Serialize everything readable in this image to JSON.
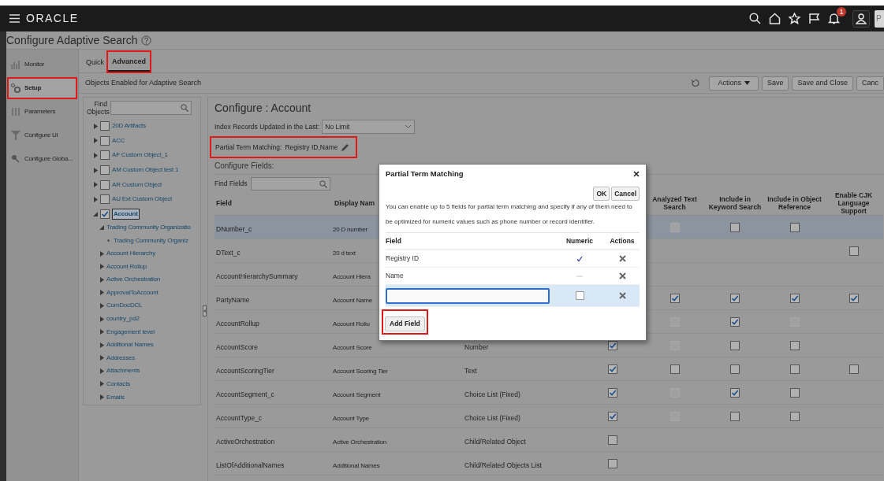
{
  "header": {
    "logo": "ORACLE",
    "notification_badge": "1",
    "avatar": "P"
  },
  "page_title": "Configure Adaptive Search",
  "nav": [
    {
      "label": "Monitor",
      "selected": false,
      "highlighted": false
    },
    {
      "label": "Setup",
      "selected": true,
      "highlighted": true
    },
    {
      "label": "Parameters",
      "selected": false,
      "highlighted": false
    },
    {
      "label": "Configure UI",
      "selected": false,
      "highlighted": false
    },
    {
      "label": "Configure Globa...",
      "selected": false,
      "highlighted": false
    }
  ],
  "tabs": [
    {
      "label": "Quick",
      "selected": false,
      "highlighted": false
    },
    {
      "label": "Advanced",
      "selected": true,
      "highlighted": true
    }
  ],
  "section_title": "Objects Enabled for Adaptive Search",
  "toolbar": [
    {
      "label": "Actions",
      "kind": "menu"
    },
    {
      "label": "Save",
      "kind": "button"
    },
    {
      "label": "Save and Close",
      "kind": "button"
    },
    {
      "label": "Canc",
      "kind": "button"
    }
  ],
  "object_search": {
    "label": "Find Objects"
  },
  "objects": [
    {
      "label": "20D Artifacts",
      "checked": false,
      "expanded": false
    },
    {
      "label": "ACC",
      "checked": false,
      "expanded": false
    },
    {
      "label": "AF Custom Object_1",
      "checked": false,
      "expanded": false
    },
    {
      "label": "AM Custom Object test 1",
      "checked": false,
      "expanded": false
    },
    {
      "label": "AR Custom Object",
      "checked": false,
      "expanded": false
    },
    {
      "label": "AU Ext Custom Object",
      "checked": false,
      "expanded": false
    },
    {
      "label": "Account",
      "checked": true,
      "expanded": true,
      "selected": true,
      "children": [
        {
          "label": "Trading Community Organizatio",
          "expanded": true,
          "children": [
            {
              "label": "Trading Community Organiz"
            }
          ]
        },
        {
          "label": "Account Hierarchy",
          "expanded": false
        },
        {
          "label": "Account Rollup",
          "expanded": false
        },
        {
          "label": "Active Orchestration",
          "expanded": false
        },
        {
          "label": "ApprovalToAccount",
          "expanded": false
        },
        {
          "label": "ComDocDCL",
          "expanded": false
        },
        {
          "label": "country_pd2",
          "expanded": false
        },
        {
          "label": "Engagement level",
          "expanded": false
        },
        {
          "label": "Additional Names",
          "expanded": false
        },
        {
          "label": "Addresses",
          "expanded": false
        },
        {
          "label": "Attachments",
          "expanded": false
        },
        {
          "label": "Contacts",
          "expanded": false
        },
        {
          "label": "Emails",
          "expanded": false
        }
      ]
    }
  ],
  "config": {
    "title": "Configure : Account",
    "index_label": "Index Records Updated in the Last:",
    "index_value": "No Limit",
    "partial_label": "Partial Term Matching:",
    "partial_value": "Registry ID,Name",
    "partial_highlighted": true,
    "fields_label": "Configure Fields:",
    "find_fields_label": "Find Fields"
  },
  "table": {
    "columns": {
      "field": "Field",
      "display_name": "Display Nam",
      "analyzed_text_search": "Analyzed Text Search",
      "keyword_search": "Include in Keyword Search",
      "object_reference": "Include in Object Reference",
      "cjk_support": "Enable CJK Language Support"
    },
    "rows": [
      {
        "field": "DNumber_c",
        "display_name": "20 D number",
        "selected": true,
        "checks": {
          "analyzed_text_search": {
            "checked": false,
            "disabled": true
          },
          "keyword_search": {
            "checked": false,
            "disabled": false
          },
          "object_reference": {
            "checked": false,
            "disabled": false
          }
        }
      },
      {
        "field": "DText_c",
        "display_name": "20 d text",
        "selected": false,
        "checks": {
          "cjk_support": {
            "checked": false,
            "disabled": false
          }
        }
      },
      {
        "field": "AccountHierarchySummary",
        "display_name": "Account Hiera",
        "selected": false
      },
      {
        "field": "PartyName",
        "display_name": "Account Name",
        "selected": false,
        "checks": {
          "analyzed_text_search": {
            "checked": true,
            "disabled": false
          },
          "keyword_search": {
            "checked": true,
            "disabled": false
          },
          "object_reference": {
            "checked": true,
            "disabled": false
          },
          "cjk_support": {
            "checked": true,
            "disabled": false
          }
        }
      },
      {
        "field": "AccountRollup",
        "display_name": "Account Rollu",
        "selected": false,
        "checks": {
          "analyzed_text_search": {
            "checked": false,
            "disabled": true
          },
          "keyword_search": {
            "checked": true,
            "disabled": false
          },
          "object_reference": {
            "checked": false,
            "disabled": true
          }
        }
      },
      {
        "field": "AccountScore",
        "display_name": "Account Score",
        "type": "Number",
        "selected": false,
        "checks": {
          "column_4": {
            "checked": true,
            "disabled": false
          },
          "analyzed_text_search": {
            "checked": false,
            "disabled": true
          },
          "keyword_search": {
            "checked": false,
            "disabled": false
          },
          "object_reference": {
            "checked": false,
            "disabled": false
          }
        }
      },
      {
        "field": "AccountScoringTier",
        "display_name": "Account Scoring Tier",
        "type": "Text",
        "selected": false,
        "checks": {
          "column_4": {
            "checked": true,
            "disabled": false
          },
          "analyzed_text_search": {
            "checked": false,
            "disabled": false
          },
          "keyword_search": {
            "checked": false,
            "disabled": false
          },
          "object_reference": {
            "checked": false,
            "disabled": false
          },
          "cjk_support": {
            "checked": false,
            "disabled": false
          }
        }
      },
      {
        "field": "AccountSegment_c",
        "display_name": "Account Segment",
        "type": "Choice List (Fixed)",
        "selected": false,
        "checks": {
          "column_4": {
            "checked": true,
            "disabled": false
          },
          "analyzed_text_search": {
            "checked": false,
            "disabled": true
          },
          "keyword_search": {
            "checked": true,
            "disabled": false
          },
          "object_reference": {
            "checked": false,
            "disabled": false
          }
        }
      },
      {
        "field": "AccountType_c",
        "display_name": "Account Type",
        "type": "Choice List (Fixed)",
        "selected": false,
        "checks": {
          "column_4": {
            "checked": true,
            "disabled": false
          },
          "analyzed_text_search": {
            "checked": false,
            "disabled": true
          },
          "keyword_search": {
            "checked": false,
            "disabled": false
          },
          "object_reference": {
            "checked": false,
            "disabled": false
          }
        }
      },
      {
        "field": "ActiveOrchestration",
        "display_name": "Active Orchestration",
        "type": "Child/Related Object",
        "selected": false,
        "checks": {
          "column_4": {
            "checked": false,
            "disabled": false
          }
        }
      },
      {
        "field": "ListOfAdditionalNames",
        "display_name": "Additional Names",
        "type": "Child/Related Objects List",
        "selected": false,
        "checks": {
          "column_4": {
            "checked": false,
            "disabled": false
          }
        }
      }
    ]
  },
  "dialog": {
    "title": "Partial Term Matching",
    "buttons": [
      "OK",
      "Cancel"
    ],
    "message": "You can enable up to 5 fields for partial term matching and specify if any of them need to be optimized for numeric values such as phone number or record identifier.",
    "columns": [
      "Field",
      "Numeric",
      "Actions"
    ],
    "rows": [
      {
        "kind": "text",
        "field": "Registry ID",
        "numeric": true,
        "selected": false
      },
      {
        "kind": "text",
        "field": "Name",
        "numeric": false,
        "selected": false
      },
      {
        "kind": "input",
        "numeric": false,
        "selected": true
      }
    ],
    "add_button": {
      "label": "Add Field",
      "highlighted": true
    }
  }
}
